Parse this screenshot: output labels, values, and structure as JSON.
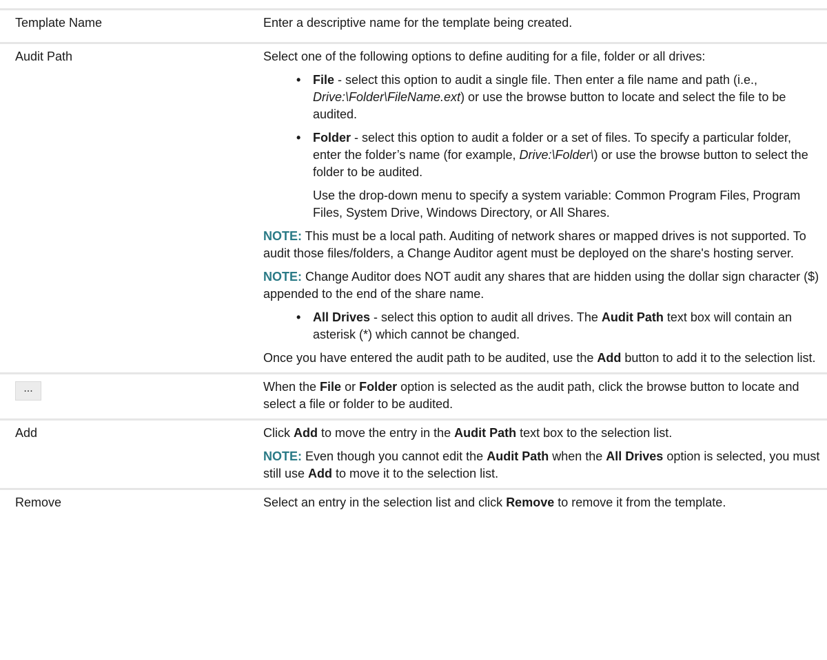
{
  "rows": [
    {
      "label": "Template Name",
      "desc": "Enter a descriptive name for the template being created."
    },
    {
      "label": "Audit Path",
      "intro": "Select one of the following options to define auditing for a file, folder or all drives:",
      "file": {
        "bullet": "•",
        "term": "File",
        "text1": " - select this option to audit a single file. Then enter a file name and path (i.e., ",
        "example": "Drive:\\Folder\\FileName.ext",
        "text2": ") or use the browse button to locate and select the file to be audited."
      },
      "folder": {
        "bullet": "•",
        "term": "Folder",
        "text1": " - select this option to audit a folder or a set of files. To specify a particular folder, enter the folder’s name (for example, ",
        "example": "Drive:\\Folder\\",
        "text2": ") or use the browse button to select the folder to be audited.",
        "dropdown_text": "Use the drop-down menu to specify a system variable: Common Program Files, Program Files, System Drive, Windows Directory, or All Shares."
      },
      "note1": {
        "label": "NOTE:",
        "text": " This must be a local path. Auditing of network shares or mapped drives is not supported. To audit those files/folders, a Change Auditor agent must be deployed on the share's hosting server."
      },
      "note2": {
        "label": "NOTE:",
        "text": " Change Auditor does NOT audit any shares that are hidden using the dollar sign character ($) appended to the end of the share name."
      },
      "all_drives": {
        "bullet": "•",
        "term": "All Drives",
        "text1": " - select this option to audit all drives. The ",
        "term2": "Audit Path",
        "text2": " text box will contain an asterisk (*) which cannot be changed."
      },
      "outro": {
        "text1": "Once you have entered the audit path to be audited, use the ",
        "term": "Add",
        "text2": " button to add it to the selection list."
      }
    },
    {
      "button_label": "...",
      "desc": {
        "text1": "When the ",
        "term1": "File",
        "text2": " or ",
        "term2": "Folder",
        "text3": " option is selected as the audit path, click the browse button to locate and select a file or folder to be audited."
      }
    },
    {
      "label": "Add",
      "desc": {
        "text1": "Click ",
        "term1": "Add",
        "text2": " to move the entry in the ",
        "term2": "Audit Path",
        "text3": " text box to the selection list."
      },
      "note": {
        "label": "NOTE:",
        "text1": " Even though you cannot edit the ",
        "term1": "Audit Path",
        "text2": " when the ",
        "term2": "All Drives",
        "text3": " option is selected, you must still use ",
        "term3": "Add",
        "text4": " to move it to the selection list."
      }
    },
    {
      "label": "Remove",
      "desc": {
        "text1": "Select an entry in the selection list and click ",
        "term1": "Remove",
        "text2": " to remove it from the template."
      }
    }
  ]
}
